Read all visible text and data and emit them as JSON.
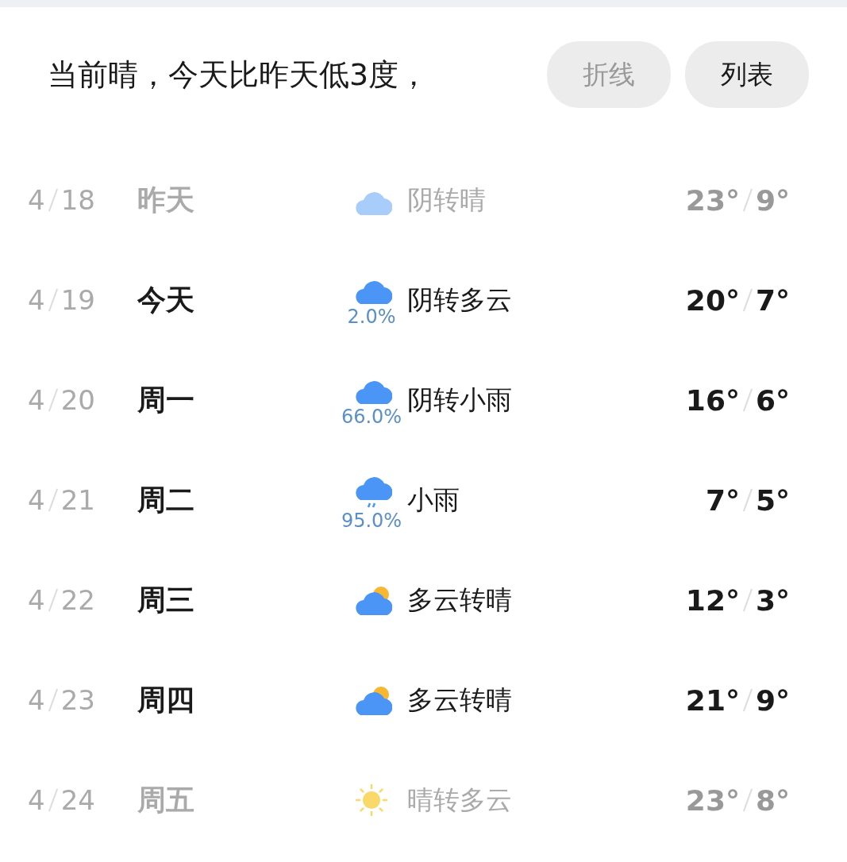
{
  "header": {
    "summary": "当前晴，今天比昨天低3度，",
    "buttons": [
      {
        "label": "折线",
        "selected": false
      },
      {
        "label": "列表",
        "selected": true
      }
    ]
  },
  "days": [
    {
      "month": "4",
      "day": "18",
      "weekday": "昨天",
      "kind": "cloud",
      "condition": "阴转晴",
      "high": "23°",
      "low": "9°",
      "dimmed": true
    },
    {
      "month": "4",
      "day": "19",
      "weekday": "今天",
      "kind": "cloud",
      "precip": "2.0%",
      "condition": "阴转多云",
      "high": "20°",
      "low": "7°",
      "dimmed": false
    },
    {
      "month": "4",
      "day": "20",
      "weekday": "周一",
      "kind": "cloud",
      "precip": "66.0%",
      "condition": "阴转小雨",
      "high": "16°",
      "low": "6°",
      "dimmed": false
    },
    {
      "month": "4",
      "day": "21",
      "weekday": "周二",
      "kind": "rain",
      "precip": "95.0%",
      "condition": "小雨",
      "high": "7°",
      "low": "5°",
      "dimmed": false
    },
    {
      "month": "4",
      "day": "22",
      "weekday": "周三",
      "kind": "partly",
      "condition": "多云转晴",
      "high": "12°",
      "low": "3°",
      "dimmed": false
    },
    {
      "month": "4",
      "day": "23",
      "weekday": "周四",
      "kind": "partly",
      "condition": "多云转晴",
      "high": "21°",
      "low": "9°",
      "dimmed": false
    },
    {
      "month": "4",
      "day": "24",
      "weekday": "周五",
      "kind": "sun",
      "condition": "晴转多云",
      "high": "23°",
      "low": "8°",
      "dimmed": true
    }
  ]
}
